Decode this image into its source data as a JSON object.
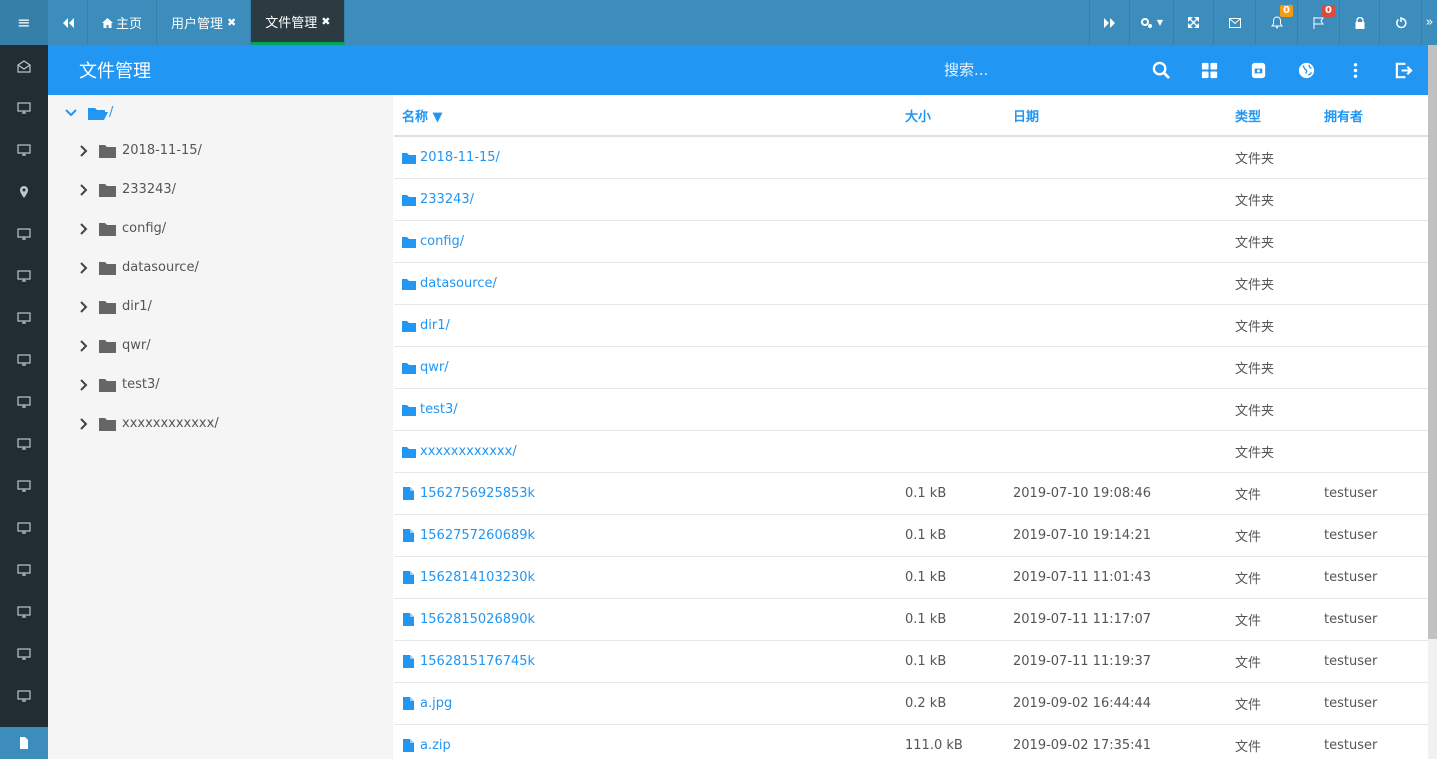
{
  "tabs": [
    {
      "label": "主页",
      "active": false,
      "closable": false,
      "icon": "home-icon"
    },
    {
      "label": "用户管理",
      "active": false,
      "closable": true
    },
    {
      "label": "文件管理",
      "active": true,
      "closable": true
    }
  ],
  "notifications": {
    "bell_count": "0",
    "flag_count": "0"
  },
  "header": {
    "title": "文件管理",
    "search_placeholder": "搜索..."
  },
  "tree": {
    "root": "/",
    "items": [
      "2018-11-15/",
      "233243/",
      "config/",
      "datasource/",
      "dir1/",
      "qwr/",
      "test3/",
      "xxxxxxxxxxxx/"
    ]
  },
  "columns": {
    "name": "名称 ▼",
    "size": "大小",
    "date": "日期",
    "type": "类型",
    "owner": "拥有者"
  },
  "rows": [
    {
      "kind": "folder",
      "name": "2018-11-15/",
      "size": "",
      "date": "",
      "type": "文件夹",
      "owner": ""
    },
    {
      "kind": "folder",
      "name": "233243/",
      "size": "",
      "date": "",
      "type": "文件夹",
      "owner": ""
    },
    {
      "kind": "folder",
      "name": "config/",
      "size": "",
      "date": "",
      "type": "文件夹",
      "owner": ""
    },
    {
      "kind": "folder",
      "name": "datasource/",
      "size": "",
      "date": "",
      "type": "文件夹",
      "owner": ""
    },
    {
      "kind": "folder",
      "name": "dir1/",
      "size": "",
      "date": "",
      "type": "文件夹",
      "owner": ""
    },
    {
      "kind": "folder",
      "name": "qwr/",
      "size": "",
      "date": "",
      "type": "文件夹",
      "owner": ""
    },
    {
      "kind": "folder",
      "name": "test3/",
      "size": "",
      "date": "",
      "type": "文件夹",
      "owner": ""
    },
    {
      "kind": "folder",
      "name": "xxxxxxxxxxxx/",
      "size": "",
      "date": "",
      "type": "文件夹",
      "owner": ""
    },
    {
      "kind": "file",
      "name": "1562756925853k",
      "size": "0.1 kB",
      "date": "2019-07-10 19:08:46",
      "type": "文件",
      "owner": "testuser"
    },
    {
      "kind": "file",
      "name": "1562757260689k",
      "size": "0.1 kB",
      "date": "2019-07-10 19:14:21",
      "type": "文件",
      "owner": "testuser"
    },
    {
      "kind": "file",
      "name": "1562814103230k",
      "size": "0.1 kB",
      "date": "2019-07-11 11:01:43",
      "type": "文件",
      "owner": "testuser"
    },
    {
      "kind": "file",
      "name": "1562815026890k",
      "size": "0.1 kB",
      "date": "2019-07-11 11:17:07",
      "type": "文件",
      "owner": "testuser"
    },
    {
      "kind": "file",
      "name": "1562815176745k",
      "size": "0.1 kB",
      "date": "2019-07-11 11:19:37",
      "type": "文件",
      "owner": "testuser"
    },
    {
      "kind": "file",
      "name": "a.jpg",
      "size": "0.2 kB",
      "date": "2019-09-02 16:44:44",
      "type": "文件",
      "owner": "testuser"
    },
    {
      "kind": "file",
      "name": "a.zip",
      "size": "111.0 kB",
      "date": "2019-09-02 17:35:41",
      "type": "文件",
      "owner": "testuser"
    }
  ],
  "colors": {
    "topbar": "#3c8dbc",
    "header": "#2196f3",
    "sidebar": "#222d32",
    "tab_active": "#2c3b41"
  }
}
